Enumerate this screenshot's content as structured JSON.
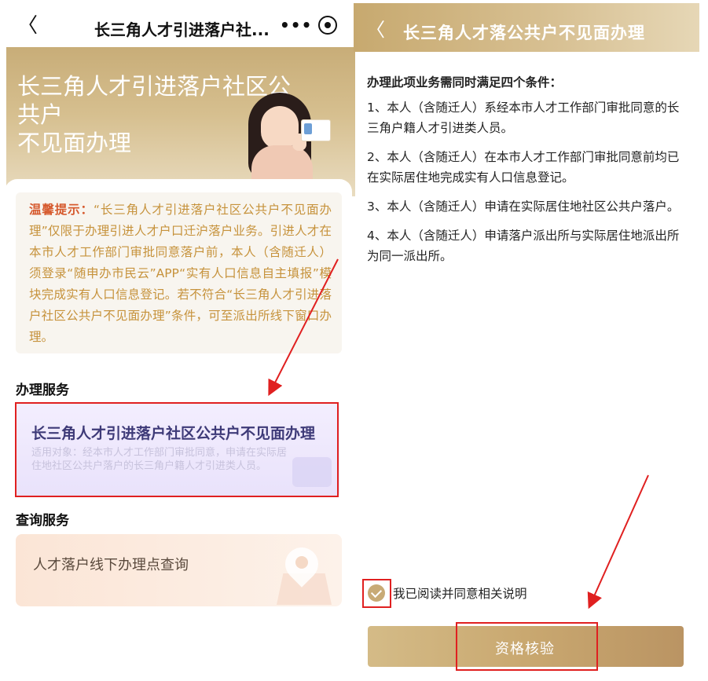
{
  "left": {
    "nav": {
      "back_glyph": "〈",
      "title": "长三角人才引进落户社...",
      "more_glyph": "•••"
    },
    "hero": {
      "title_line1": "长三角人才引进落户社区公共户",
      "title_line2": "不见面办理"
    },
    "notice": {
      "label": "温馨提示：",
      "text": "“长三角人才引进落户社区公共户不见面办理”仅限于办理引进人才户口迁沪落户业务。引进人才在本市人才工作部门审批同意落户前，本人（含随迁人）须登录“随申办市民云”APP“实有人口信息自主填报”模块完成实有人口信息登记。若不符合“长三角人才引进落户社区公共户不见面办理”条件，可至派出所线下窗口办理。"
    },
    "service_section": {
      "title": "办理服务",
      "card_title": "长三角人才引进落户社区公共户不见面办理",
      "card_desc": "适用对象：经本市人才工作部门审批同意，申请在实际居住地社区公共户落户的长三角户籍人才引进类人员。"
    },
    "query_section": {
      "title": "查询服务",
      "card_title": "人才落户线下办理点查询"
    }
  },
  "right": {
    "header": {
      "back_glyph": "〈",
      "title": "长三角人才落公共户不见面办理"
    },
    "conditions_heading": "办理此项业务需同时满足四个条件：",
    "conditions": [
      "1、本人（含随迁人）系经本市人才工作部门审批同意的长三角户籍人才引进类人员。",
      "2、本人（含随迁人）在本市人才工作部门审批同意前均已在实际居住地完成实有人口信息登记。",
      "3、本人（含随迁人）申请在实际居住地社区公共户落户。",
      "4、本人（含随迁人）申请落户派出所与实际居住地派出所为同一派出所。"
    ],
    "agree_label": "我已阅读并同意相关说明",
    "agree_checked": true,
    "verify_button": "资格核验"
  },
  "colors": {
    "accent_gold": "#c8aa75",
    "highlight_red": "#e02020",
    "notice_text": "#c6923b"
  }
}
